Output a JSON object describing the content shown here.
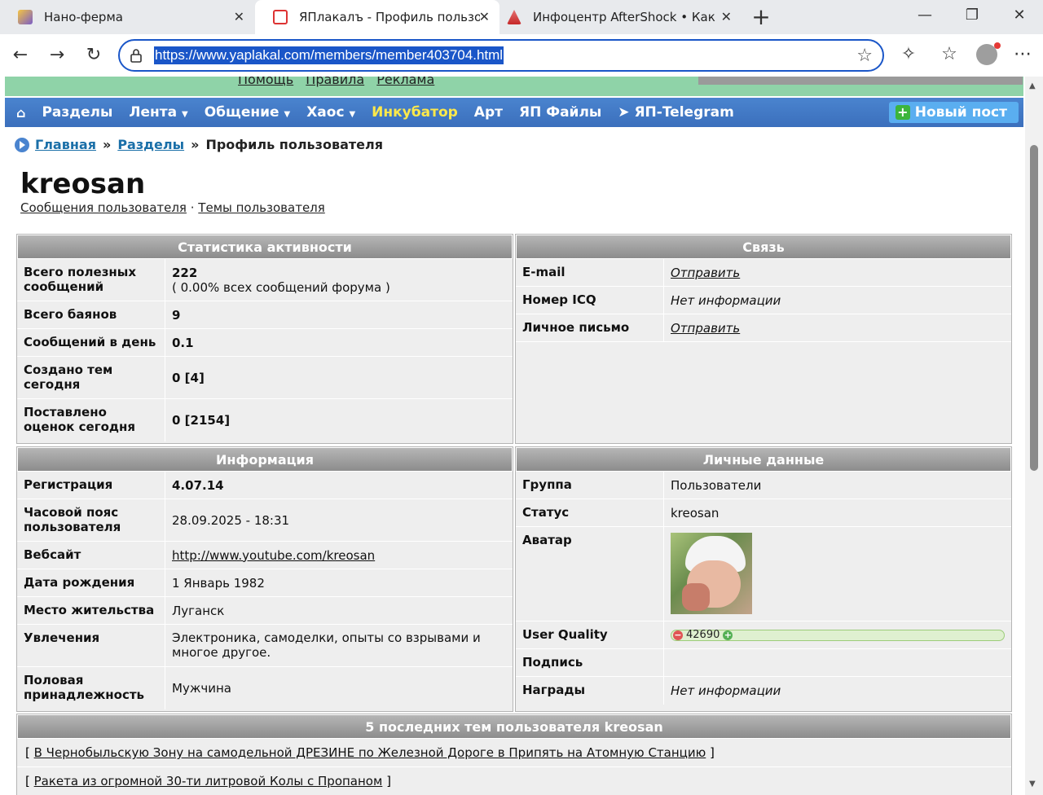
{
  "browser": {
    "tabs": [
      {
        "title": "Нано-ферма",
        "active": false
      },
      {
        "title": "ЯПлакалъ - Профиль пользовате",
        "active": true
      },
      {
        "title": "Инфоцентр AfterShock • Каким б",
        "active": false
      }
    ],
    "url": "https://www.yaplakal.com/members/member403704.html"
  },
  "site": {
    "top_links": [
      "Помощь",
      "Правила",
      "Реклама"
    ],
    "menu": [
      {
        "label": "Разделы",
        "dropdown": false,
        "highlight": false
      },
      {
        "label": "Лента",
        "dropdown": true,
        "highlight": false
      },
      {
        "label": "Общение",
        "dropdown": true,
        "highlight": false
      },
      {
        "label": "Хаос",
        "dropdown": true,
        "highlight": false
      },
      {
        "label": "Инкубатор",
        "dropdown": false,
        "highlight": true
      },
      {
        "label": "Арт",
        "dropdown": false,
        "highlight": false
      },
      {
        "label": "ЯП Файлы",
        "dropdown": false,
        "highlight": false
      },
      {
        "label": "ЯП-Telegram",
        "dropdown": false,
        "highlight": false
      }
    ],
    "new_post": "Новый пост",
    "colors": {
      "menu": "#3b6fbc",
      "highlight": "#ffe94a",
      "green_band": "#8fd3a8"
    }
  },
  "breadcrumb": {
    "home": "Главная",
    "sections": "Разделы",
    "current": "Профиль пользователя"
  },
  "profile": {
    "username": "kreosan",
    "link_messages": "Сообщения пользователя",
    "link_topics": "Темы пользователя"
  },
  "stats": {
    "title": "Статистика активности",
    "rows": [
      {
        "k": "Всего полезных сообщений",
        "v": "222",
        "sub": "( 0.00% всех сообщений форума )"
      },
      {
        "k": "Всего баянов",
        "v": "9"
      },
      {
        "k": "Сообщений в день",
        "v": "0.1"
      },
      {
        "k": "Создано тем сегодня",
        "v": "0 [4]"
      },
      {
        "k": "Поставлено оценок сегодня",
        "v": "0 [2154]"
      }
    ]
  },
  "contact": {
    "title": "Связь",
    "rows": [
      {
        "k": "E-mail",
        "v": "Отправить"
      },
      {
        "k": "Номер ICQ",
        "v": "Нет информации"
      },
      {
        "k": "Личное письмо",
        "v": "Отправить"
      }
    ]
  },
  "info": {
    "title": "Информация",
    "rows": [
      {
        "k": "Регистрация",
        "v": "4.07.14"
      },
      {
        "k": "Часовой пояс пользователя",
        "v": "28.09.2025 - 18:31"
      },
      {
        "k": "Вебсайт",
        "v": "http://www.youtube.com/kreosan"
      },
      {
        "k": "Дата рождения",
        "v": "1 Январь 1982"
      },
      {
        "k": "Место жительства",
        "v": "Луганск"
      },
      {
        "k": "Увлечения",
        "v": "Электроника, самоделки, опыты со взрывами и многое другое."
      },
      {
        "k": "Половая принадлежность",
        "v": "Мужчина"
      }
    ]
  },
  "personal": {
    "title": "Личные данные",
    "rows": [
      {
        "k": "Группа",
        "v": "Пользователи"
      },
      {
        "k": "Статус",
        "v": "kreosan"
      },
      {
        "k": "Аватар",
        "v": ""
      },
      {
        "k": "User Quality",
        "v": "42690"
      },
      {
        "k": "Подпись",
        "v": ""
      },
      {
        "k": "Награды",
        "v": "Нет информации"
      }
    ]
  },
  "last_topics": {
    "title": "5 последних тем пользователя kreosan",
    "items": [
      "В Чернобыльскую Зону на самодельной ДРЕЗИНЕ по Железной Дороге в Припять на Атомную Станцию",
      "Ракета из огромной 30-ти литровой Колы с Пропаном"
    ]
  }
}
